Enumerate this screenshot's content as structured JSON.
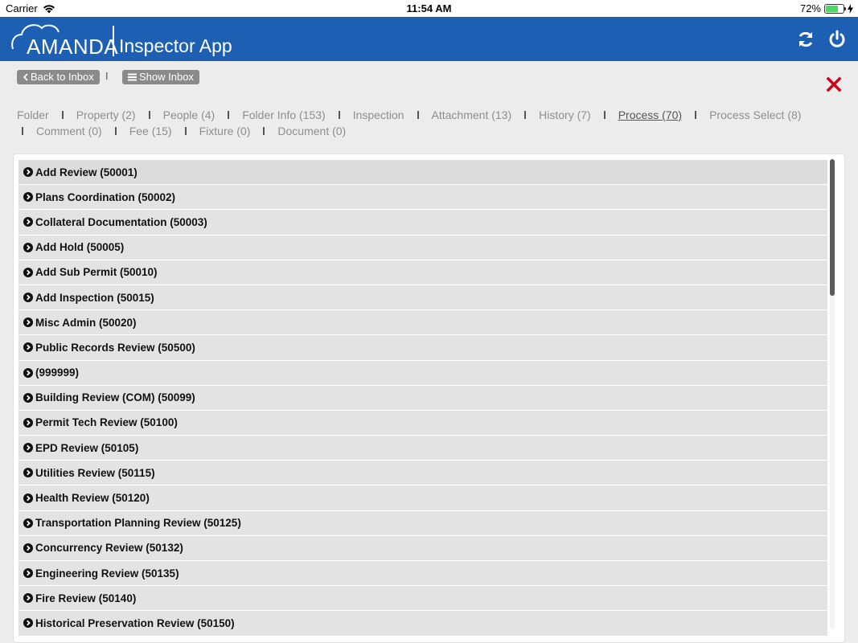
{
  "status_bar": {
    "carrier": "Carrier",
    "time": "11:54 AM",
    "battery": "72%",
    "battery_level": 0.72
  },
  "header": {
    "logo_text": "AMANDA",
    "app_name": "Inspector App",
    "color": "#1c5fb3",
    "icons": [
      "refresh-icon",
      "power-icon"
    ]
  },
  "toolbar": {
    "back_label": "Back to Inbox",
    "show_inbox_label": "Show Inbox",
    "separator": "I"
  },
  "tabs": [
    {
      "label": "Folder"
    },
    {
      "label": "Property (2)"
    },
    {
      "label": "People (4)"
    },
    {
      "label": "Folder Info (153)"
    },
    {
      "label": "Inspection"
    },
    {
      "label": "Attachment (13)"
    },
    {
      "label": "History (7)"
    },
    {
      "label": "Process (70)",
      "active": true
    },
    {
      "label": "Process Select (8)"
    },
    {
      "label": "Comment (0)"
    },
    {
      "label": "Fee (15)"
    },
    {
      "label": "Fixture (0)"
    },
    {
      "label": "Document (0)"
    }
  ],
  "process_list": [
    "Add Review (50001)",
    "Plans Coordination (50002)",
    "Collateral Documentation (50003)",
    "Add Hold (50005)",
    "Add Sub Permit (50010)",
    "Add Inspection (50015)",
    "Misc Admin (50020)",
    "Public Records Review (50500)",
    " (999999)",
    "Building Review (COM) (50099)",
    "Permit Tech Review (50100)",
    "EPD Review (50105)",
    "Utilities Review (50115)",
    "Health Review (50120)",
    "Transportation Planning Review (50125)",
    "Concurrency Review (50132)",
    "Engineering Review (50135)",
    "Fire Review (50140)",
    "Historical Preservation Review (50150)"
  ],
  "colors": {
    "accent": "#1c5fb3",
    "close": "#d0021b"
  }
}
